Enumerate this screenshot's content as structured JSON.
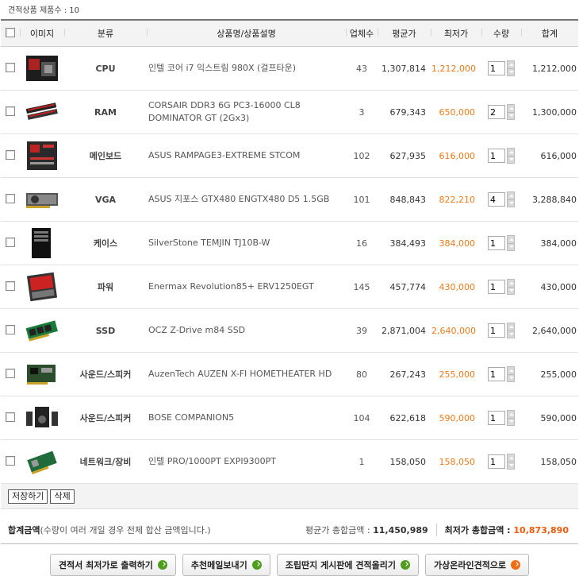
{
  "header": {
    "product_count": "견적상품 제품수 : 10"
  },
  "columns": [
    "이미지",
    "분류",
    "상품명/상품설명",
    "업체수",
    "평균가",
    "최저가",
    "수량",
    "합계"
  ],
  "rows": [
    {
      "category": "CPU",
      "name": "인텔 코어 i7 익스트림 980X (걸프타운)",
      "vendors": "43",
      "avg": "1,307,814",
      "low": "1,212,000",
      "qty": "1",
      "sum": "1,212,000",
      "icon": "cpu-box-icon"
    },
    {
      "category": "RAM",
      "name": "CORSAIR DDR3 6G PC3-16000 CL8 DOMINATOR GT (2Gx3)",
      "vendors": "3",
      "avg": "679,343",
      "low": "650,000",
      "qty": "2",
      "sum": "1,300,000",
      "icon": "ram-icon"
    },
    {
      "category": "메인보드",
      "name": "ASUS RAMPAGE3-EXTREME STCOM",
      "vendors": "102",
      "avg": "627,935",
      "low": "616,000",
      "qty": "1",
      "sum": "616,000",
      "icon": "mainboard-icon"
    },
    {
      "category": "VGA",
      "name": "ASUS 지포스 GTX480 ENGTX480 D5 1.5GB",
      "vendors": "101",
      "avg": "848,843",
      "low": "822,210",
      "qty": "4",
      "sum": "3,288,840",
      "icon": "vga-card-icon"
    },
    {
      "category": "케이스",
      "name": "SilverStone TEMJIN TJ10B-W",
      "vendors": "16",
      "avg": "384,493",
      "low": "384,000",
      "qty": "1",
      "sum": "384,000",
      "icon": "pc-case-icon"
    },
    {
      "category": "파워",
      "name": "Enermax Revolution85+ ERV1250EGT",
      "vendors": "145",
      "avg": "457,774",
      "low": "430,000",
      "qty": "1",
      "sum": "430,000",
      "icon": "psu-box-icon"
    },
    {
      "category": "SSD",
      "name": "OCZ Z-Drive m84 SSD",
      "vendors": "39",
      "avg": "2,871,004",
      "low": "2,640,000",
      "qty": "1",
      "sum": "2,640,000",
      "icon": "ssd-card-icon"
    },
    {
      "category": "사운드/스피커",
      "name": "AuzenTech AUZEN X-FI HOMETHEATER HD",
      "vendors": "80",
      "avg": "267,243",
      "low": "255,000",
      "qty": "1",
      "sum": "255,000",
      "icon": "sound-card-icon"
    },
    {
      "category": "사운드/스피커",
      "name": "BOSE COMPANION5",
      "vendors": "104",
      "avg": "622,618",
      "low": "590,000",
      "qty": "1",
      "sum": "590,000",
      "icon": "speakers-icon"
    },
    {
      "category": "네트워크/장비",
      "name": "인텔 PRO/1000PT EXPI9300PT",
      "vendors": "1",
      "avg": "158,050",
      "low": "158,050",
      "qty": "1",
      "sum": "158,050",
      "icon": "network-card-icon"
    }
  ],
  "buttons": {
    "save": "저장하기",
    "delete": "삭제"
  },
  "totals": {
    "label": "합계금액",
    "note": "(수량이 여러 개일 경우 전체 합산 금액입니다.)",
    "avg_label": "평균가 총합금액 : ",
    "avg_value": "11,450,989",
    "low_label": "최저가 총합금액 : ",
    "low_value": "10,873,890"
  },
  "actions": [
    "견적서 최저가로 출력하기",
    "추천메일보내기",
    "조립딴지 게시판에 견적올리기",
    "가상온라인견적으로"
  ],
  "colors": {
    "lowest_price": "#f07a1a",
    "total_lowest": "#f05a0a",
    "go_green": "#4f9c1f",
    "go_orange": "#ef6d12"
  }
}
